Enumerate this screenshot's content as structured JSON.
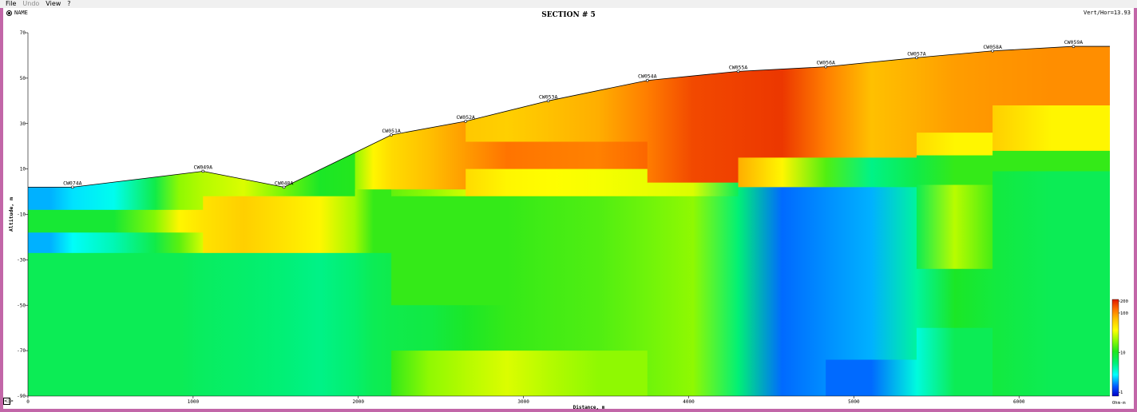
{
  "menu": [
    {
      "label": "File",
      "enabled": true
    },
    {
      "label": "Undo",
      "enabled": false
    },
    {
      "label": "View",
      "enabled": true
    },
    {
      "label": "?",
      "enabled": true
    }
  ],
  "header": {
    "name_toggle": "NAME",
    "title": "SECTION # 5",
    "ratio": "Vert/Hor=13.93"
  },
  "nav_button": "<|>",
  "chart_data": {
    "type": "heatmap",
    "title": "SECTION # 5",
    "xlabel": "Distance, m",
    "ylabel": "Altitude, m",
    "xlim": [
      0,
      6550
    ],
    "ylim": [
      -90,
      70
    ],
    "xticks": [
      0,
      1000,
      2000,
      3000,
      4000,
      5000,
      6000
    ],
    "yticks": [
      70,
      50,
      30,
      10,
      -10,
      -30,
      -50,
      -70,
      -90
    ],
    "stations": [
      {
        "name": "CW074A",
        "x": 270,
        "elev": 2
      },
      {
        "name": "CW049A",
        "x": 1060,
        "elev": 9
      },
      {
        "name": "CW048A",
        "x": 1550,
        "elev": 2
      },
      {
        "name": "CW051A",
        "x": 2200,
        "elev": 25
      },
      {
        "name": "CW052A",
        "x": 2650,
        "elev": 31
      },
      {
        "name": "CW053A",
        "x": 3150,
        "elev": 40
      },
      {
        "name": "CW054A",
        "x": 3750,
        "elev": 49
      },
      {
        "name": "CW055A",
        "x": 4300,
        "elev": 53
      },
      {
        "name": "CW056A",
        "x": 4830,
        "elev": 55
      },
      {
        "name": "CW057A",
        "x": 5380,
        "elev": 59
      },
      {
        "name": "CW058A",
        "x": 5840,
        "elev": 62
      },
      {
        "name": "CW059A",
        "x": 6330,
        "elev": 64
      }
    ],
    "colorbar": {
      "label": "Ohm-m",
      "scale": "log",
      "range": [
        0.8,
        220
      ],
      "ticks": [
        {
          "value": 1,
          "label": "1"
        },
        {
          "value": 10,
          "label": "10"
        },
        {
          "value": 100,
          "label": "100"
        },
        {
          "value": 200,
          "label": "200"
        }
      ]
    },
    "resistivity_columns": [
      {
        "x0": 0,
        "x1": 270,
        "layers": [
          {
            "top": 2,
            "res": 2
          },
          {
            "top": -8,
            "res": 9
          },
          {
            "top": -18,
            "res": 2
          },
          {
            "top": -27,
            "res": 7
          }
        ]
      },
      {
        "x0": 270,
        "x1": 770,
        "layers": [
          {
            "top": 2,
            "res": 3
          },
          {
            "top": -8,
            "res": 9
          },
          {
            "top": -18,
            "res": 4
          },
          {
            "top": -27,
            "res": 7
          }
        ]
      },
      {
        "x0": 770,
        "x1": 1060,
        "layers": [
          {
            "top": 6,
            "res": 20
          },
          {
            "top": -8,
            "res": 40
          },
          {
            "top": -18,
            "res": 15
          },
          {
            "top": -27,
            "res": 7
          }
        ]
      },
      {
        "x0": 1060,
        "x1": 1550,
        "layers": [
          {
            "top": 9,
            "res": 30
          },
          {
            "top": -2,
            "res": 60
          },
          {
            "top": -27,
            "res": 6
          }
        ]
      },
      {
        "x0": 1550,
        "x1": 1980,
        "layers": [
          {
            "top": 2,
            "res": 10
          },
          {
            "top": -2,
            "res": 40
          },
          {
            "top": -27,
            "res": 5
          }
        ]
      },
      {
        "x0": 1980,
        "x1": 2200,
        "layers": [
          {
            "top": 19,
            "res": 40
          },
          {
            "top": 1,
            "res": 12
          },
          {
            "top": -27,
            "res": 7
          }
        ]
      },
      {
        "x0": 2200,
        "x1": 2650,
        "layers": [
          {
            "top": 25,
            "res": 70
          },
          {
            "top": 1,
            "res": 20
          },
          {
            "top": -2,
            "res": 12
          },
          {
            "top": -50,
            "res": 8
          },
          {
            "top": -70,
            "res": 20
          }
        ]
      },
      {
        "x0": 2650,
        "x1": 3150,
        "layers": [
          {
            "top": 31,
            "res": 60
          },
          {
            "top": 22,
            "res": 120
          },
          {
            "top": 10,
            "res": 40
          },
          {
            "top": -2,
            "res": 12
          },
          {
            "top": -50,
            "res": 12
          },
          {
            "top": -70,
            "res": 30
          }
        ]
      },
      {
        "x0": 3150,
        "x1": 3750,
        "layers": [
          {
            "top": 40,
            "res": 80
          },
          {
            "top": 22,
            "res": 110
          },
          {
            "top": 10,
            "res": 35
          },
          {
            "top": -2,
            "res": 14
          },
          {
            "top": -70,
            "res": 20
          }
        ]
      },
      {
        "x0": 3750,
        "x1": 4300,
        "layers": [
          {
            "top": 49,
            "res": 160
          },
          {
            "top": 4,
            "res": 30
          },
          {
            "top": -2,
            "res": 20
          }
        ]
      },
      {
        "x0": 4300,
        "x1": 4830,
        "layers": [
          {
            "top": 53,
            "res": 180
          },
          {
            "top": 15,
            "res": 40
          },
          {
            "top": 2,
            "res": 1.5
          }
        ]
      },
      {
        "x0": 4830,
        "x1": 5380,
        "layers": [
          {
            "top": 55,
            "res": 70
          },
          {
            "top": 15,
            "res": 5
          },
          {
            "top": 2,
            "res": 2
          },
          {
            "top": -74,
            "res": 1.5
          }
        ]
      },
      {
        "x0": 5380,
        "x1": 5840,
        "layers": [
          {
            "top": 59,
            "res": 90
          },
          {
            "top": 26,
            "res": 40
          },
          {
            "top": 16,
            "res": 12
          },
          {
            "top": 3,
            "res": 25
          },
          {
            "top": -34,
            "res": 10
          },
          {
            "top": -60,
            "res": 7
          }
        ]
      },
      {
        "x0": 5840,
        "x1": 6550,
        "layers": [
          {
            "top": 64,
            "res": 100
          },
          {
            "top": 38,
            "res": 40
          },
          {
            "top": 18,
            "res": 12
          },
          {
            "top": 9,
            "res": 7
          }
        ]
      }
    ]
  }
}
